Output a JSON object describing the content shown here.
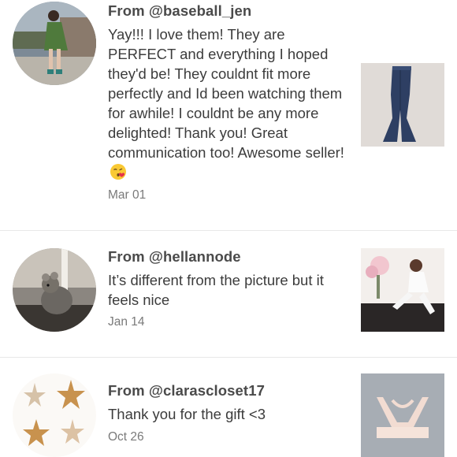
{
  "reviews": [
    {
      "from": "From @baseball_jen",
      "text": "Yay!!! I love them! They are PERFECT and everything I hoped they'd be! They couldnt fit more perfectly and Id been watching them for awhile! I couldnt be any more delighted! Thank you! Great communication too! Awesome seller!",
      "emoji": "face-blowing-kiss-emoji",
      "date": "Mar 01",
      "avatar_icon": "person-on-street-photo",
      "thumb_icon": "flare-jeans-photo"
    },
    {
      "from": "From @hellannode",
      "text": "It’s different from the picture but it feels nice",
      "date": "Jan 14",
      "avatar_icon": "chinchilla-photo",
      "thumb_icon": "woman-white-outfit-photo"
    },
    {
      "from": "From @clarascloset17",
      "text": "Thank you for the gift <3",
      "date": "Oct 26",
      "avatar_icon": "starfish-photo",
      "thumb_icon": "pink-bralette-photo"
    }
  ],
  "colors": {
    "text": "#3c3c3c",
    "username": "#4a4a4a",
    "date": "#7a7a7a",
    "divider": "#e8e8e8"
  }
}
